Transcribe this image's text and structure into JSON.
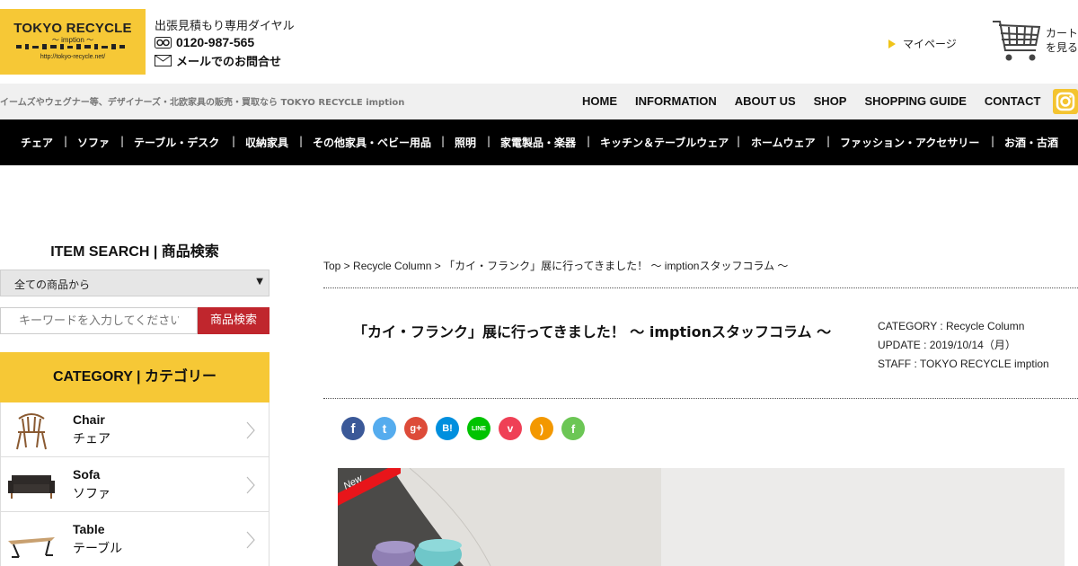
{
  "header": {
    "logo": {
      "title": "TOKYO RECYCLE",
      "subtitle": "～ imption ～",
      "url": "http://tokyo-recycle.net/"
    },
    "contact": {
      "label": "出張見積もり専用ダイヤル",
      "phone": "0120-987-565",
      "mail": "メールでのお問合せ"
    },
    "mypage": "マイページ",
    "cart": {
      "line1": "カート",
      "line2": "を見る"
    }
  },
  "subbar": {
    "tagline": "イームズやウェグナー等、デザイナーズ・北欧家具の販売・買取なら TOKYO RECYCLE imption",
    "nav": [
      "HOME",
      "INFORMATION",
      "ABOUT US",
      "SHOP",
      "SHOPPING GUIDE",
      "CONTACT"
    ]
  },
  "catnav": [
    "チェア",
    "ソファ",
    "テーブル・デスク",
    "収納家具",
    "その他家具・ベビー用品",
    "照明",
    "家電製品・楽器",
    "キッチン＆テーブルウェア",
    "ホームウェア",
    "ファッション・アクセサリー",
    "お酒・古酒"
  ],
  "sidebar": {
    "search_title": "ITEM SEARCH | 商品検索",
    "select_value": "全ての商品から",
    "input_placeholder": "キーワードを入力してください",
    "search_button": "商品検索",
    "category_title": "CATEGORY | カテゴリー",
    "categories": [
      {
        "en": "Chair",
        "ja": "チェア"
      },
      {
        "en": "Sofa",
        "ja": "ソファ"
      },
      {
        "en": "Table",
        "ja": "テーブル"
      }
    ]
  },
  "main": {
    "breadcrumb": "Top > Recycle Column > 「カイ・フランク」展に行ってきました！ ～ imptionスタッフコラム ～",
    "title": "「カイ・フランク」展に行ってきました！ ～ imptionスタッフコラム ～",
    "meta": {
      "category": "CATEGORY :  Recycle Column",
      "update": "UPDATE :  2019/10/14（月）",
      "staff": "STAFF :  TOKYO RECYCLE imption"
    },
    "share": [
      {
        "name": "facebook",
        "glyph": "f",
        "color": "#3b5998"
      },
      {
        "name": "twitter",
        "glyph": "t",
        "color": "#55acee"
      },
      {
        "name": "google-plus",
        "glyph": "g+",
        "color": "#dd4b39"
      },
      {
        "name": "hatena",
        "glyph": "B!",
        "color": "#008fde"
      },
      {
        "name": "line",
        "glyph": "LINE",
        "color": "#00c300"
      },
      {
        "name": "pocket",
        "glyph": "v",
        "color": "#ef4056"
      },
      {
        "name": "rss",
        "glyph": ")",
        "color": "#f39800"
      },
      {
        "name": "feedly",
        "glyph": "f",
        "color": "#6cc655"
      }
    ],
    "badge": "New"
  }
}
